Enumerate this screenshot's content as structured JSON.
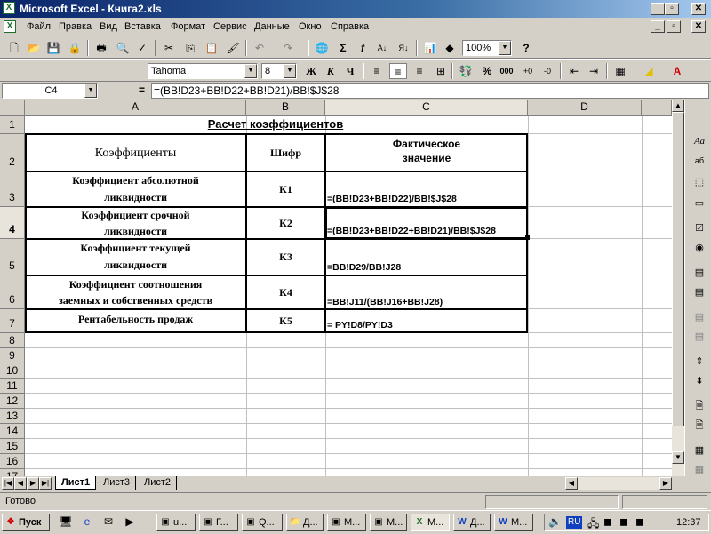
{
  "window": {
    "title": "Microsoft Excel - Книга2.xls",
    "app_icon": "excel-icon"
  },
  "menu": [
    "Файл",
    "Правка",
    "Вид",
    "Вставка",
    "Формат",
    "Сервис",
    "Данные",
    "Окно",
    "Справка"
  ],
  "toolbar": {
    "zoom": "100%",
    "font": "Tahoma",
    "size": "8",
    "bold": "Ж",
    "italic": "К",
    "underline": "Ч",
    "percent": "%",
    "thousands": "000"
  },
  "formula_bar": {
    "name_box": "C4",
    "eq": "=",
    "formula": "=(BB!D23+BB!D22+BB!D21)/BB!$J$28"
  },
  "columns": [
    "A",
    "B",
    "C",
    "D"
  ],
  "rows": [
    "1",
    "2",
    "3",
    "4",
    "5",
    "6",
    "7",
    "8",
    "9",
    "10",
    "11",
    "12",
    "13",
    "14",
    "15",
    "16",
    "17"
  ],
  "table": {
    "title": "Расчет коэффициентов",
    "headers": {
      "a": "Коэффициенты",
      "b": "Шифр",
      "c_line1": "Фактическое",
      "c_line2": "значение"
    },
    "rows": [
      {
        "name1": "Коэффициент абсолютной",
        "name2": "ликвидности",
        "code": "К1",
        "formula": "=(BB!D23+BB!D22)/BB!$J$28"
      },
      {
        "name1": "Коэффициент срочной",
        "name2": "ликвидности",
        "code": "К2",
        "formula": "=(BB!D23+BB!D22+BB!D21)/BB!$J$28"
      },
      {
        "name1": "Коэффициент текущей",
        "name2": "ликвидности",
        "code": "К3",
        "formula": "=BB!D29/BB!J28"
      },
      {
        "name1": "Коэффициент соотношения",
        "name2": "заемных и собственных средств",
        "code": "К4",
        "formula": "=BB!J11/(BB!J16+BB!J28)"
      },
      {
        "name1": "Рентабельность продаж",
        "name2": "",
        "code": "К5",
        "formula": "= PY!D8/PY!D3"
      }
    ]
  },
  "sheets": [
    "Лист1",
    "Лист3",
    "Лист2"
  ],
  "status": "Готово",
  "taskbar": {
    "start": "Пуск",
    "items": [
      "u...",
      "Г...",
      "Q...",
      "Д...",
      "М...",
      "М...",
      "М...",
      "Д...",
      "М..."
    ],
    "lang": "RU",
    "clock": "12:37"
  }
}
